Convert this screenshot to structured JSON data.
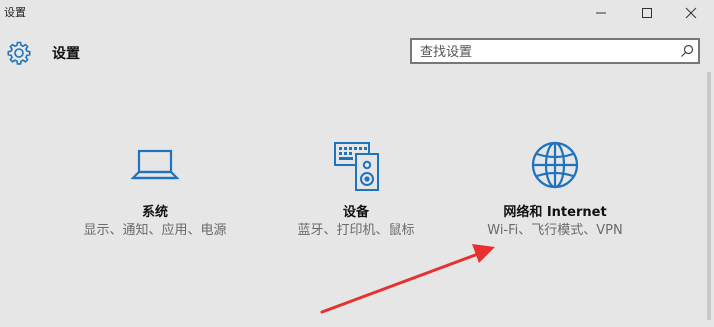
{
  "window": {
    "title": "设置"
  },
  "header": {
    "page_title": "设置",
    "search_placeholder": "查找设置"
  },
  "colors": {
    "accent": "#1e73be",
    "annotation": "#e8312f",
    "background": "#e6e6e6"
  },
  "tiles": [
    {
      "name": "系统",
      "desc": "显示、通知、应用、电源",
      "icon": "laptop-icon"
    },
    {
      "name": "设备",
      "desc": "蓝牙、打印机、鼠标",
      "icon": "keyboard-speaker-icon"
    },
    {
      "name": "网络和 Internet",
      "desc": "Wi-Fi、飞行模式、VPN",
      "icon": "globe-icon"
    }
  ]
}
